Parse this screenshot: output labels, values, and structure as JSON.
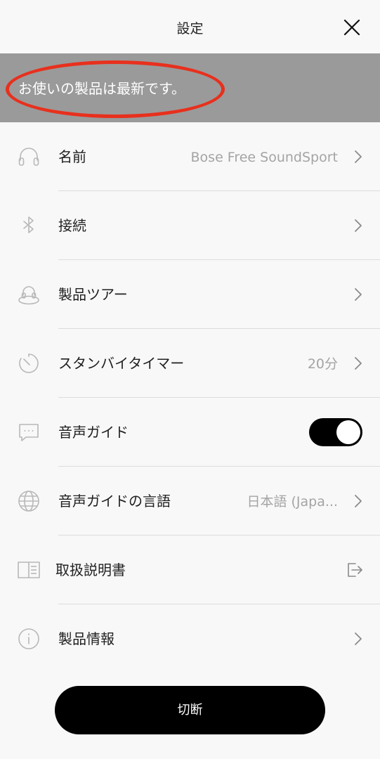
{
  "header": {
    "title": "設定",
    "close_icon": "close-icon"
  },
  "banner": {
    "message": "お使いの製品は最新です。",
    "annotation_color": "#e8301d",
    "background": "#9a9a9a"
  },
  "rows": [
    {
      "label": "名前",
      "value": "Bose Free SoundSport",
      "icon": "headphones-icon",
      "action": "chevron"
    },
    {
      "label": "接続",
      "value": "",
      "icon": "bluetooth-icon",
      "action": "chevron"
    },
    {
      "label": "製品ツアー",
      "value": "",
      "icon": "product-tour-icon",
      "action": "chevron"
    },
    {
      "label": "スタンバイタイマー",
      "value": "20分",
      "icon": "timer-icon",
      "action": "chevron"
    },
    {
      "label": "音声ガイド",
      "value": "",
      "icon": "speech-bubble-icon",
      "action": "toggle",
      "toggle_on": true
    },
    {
      "label": "音声ガイドの言語",
      "value": "日本語 (Japa...",
      "icon": "globe-icon",
      "action": "chevron"
    },
    {
      "label": "取扱説明書",
      "value": "",
      "icon": "book-icon",
      "action": "external-link"
    },
    {
      "label": "製品情報",
      "value": "",
      "icon": "info-icon",
      "action": "chevron"
    }
  ],
  "disconnect_button": {
    "label": "切断"
  }
}
